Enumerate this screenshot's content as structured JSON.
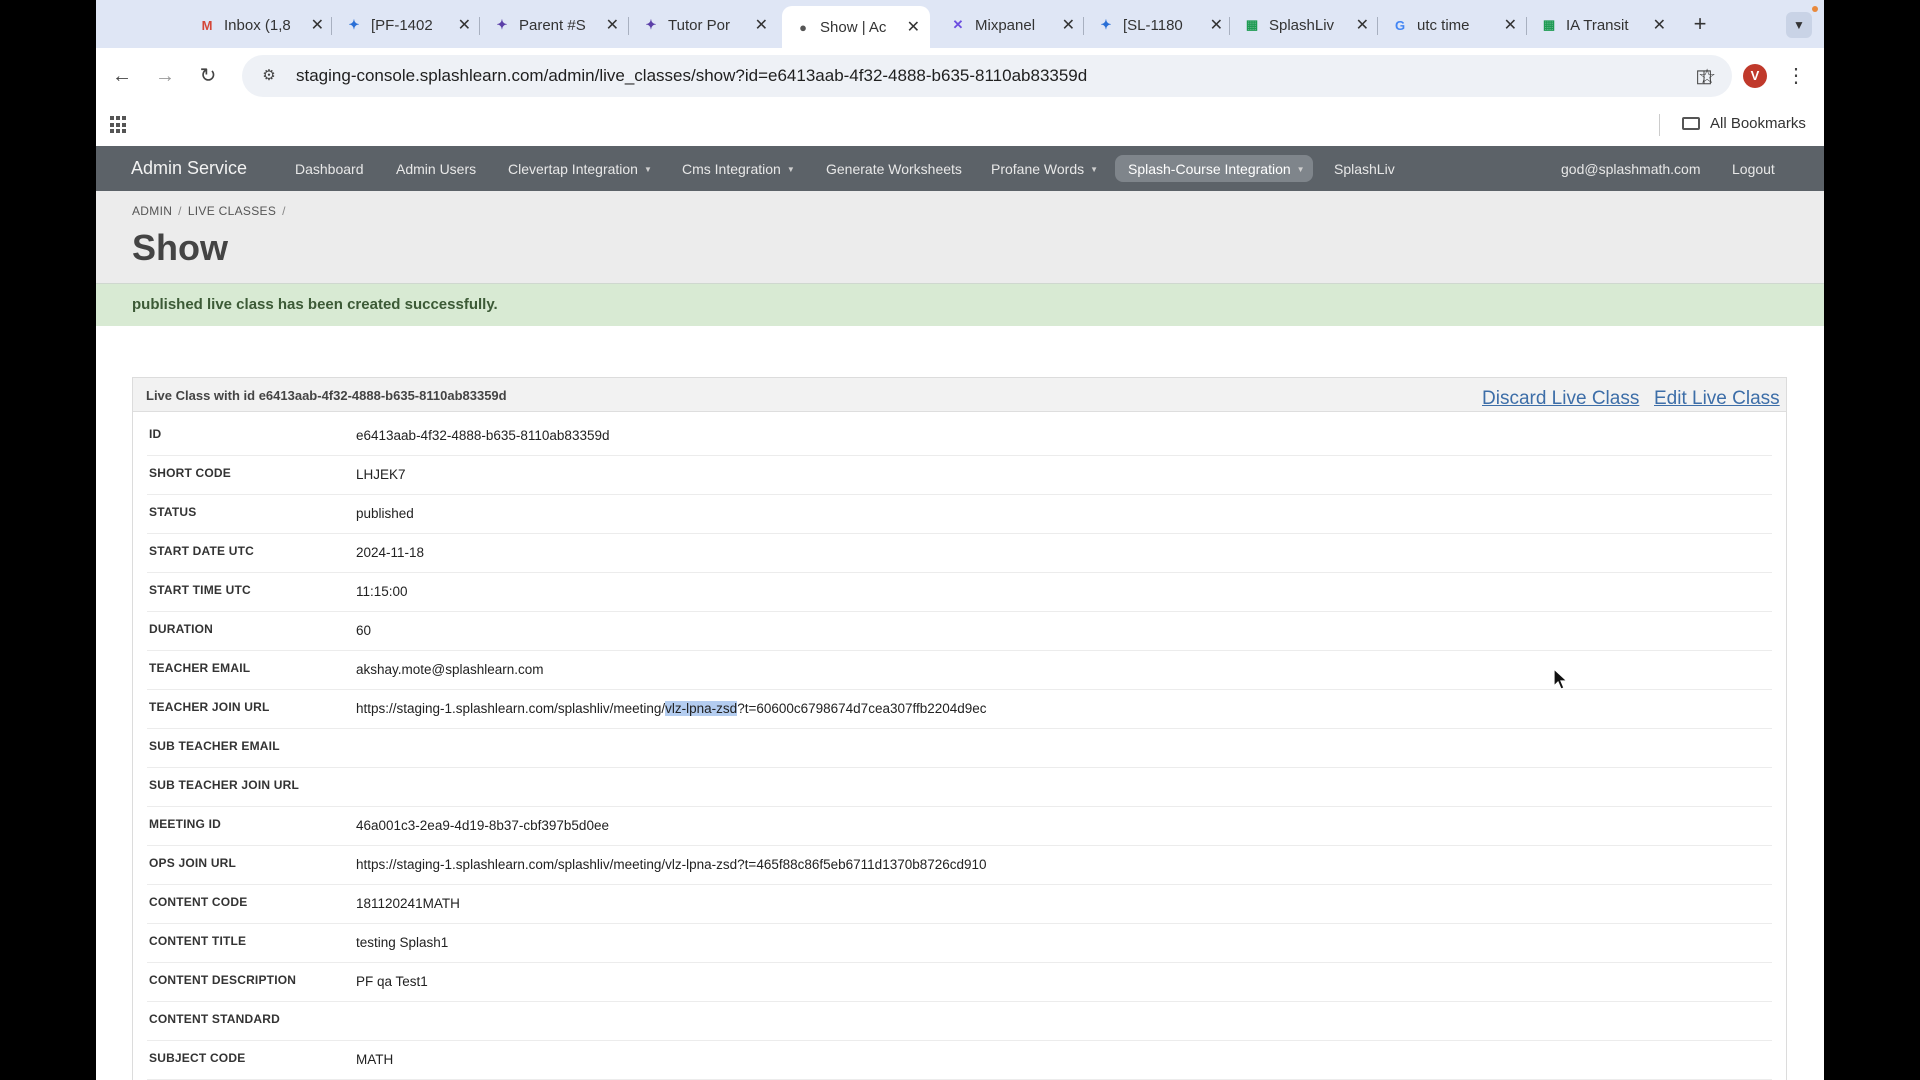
{
  "browser": {
    "tabs": [
      {
        "label": "Inbox (1,8",
        "icon": "gmail-icon",
        "active": false
      },
      {
        "label": "[PF-1402",
        "icon": "jira-icon",
        "active": false
      },
      {
        "label": "Parent #S",
        "icon": "app-icon",
        "active": false
      },
      {
        "label": "Tutor Por",
        "icon": "app-icon",
        "active": false
      },
      {
        "label": "Show | Ac",
        "icon": "globe-icon",
        "active": true
      },
      {
        "label": "Mixpanel",
        "icon": "mixpanel-icon",
        "active": false
      },
      {
        "label": "[SL-1180",
        "icon": "jira-icon",
        "active": false
      },
      {
        "label": "SplashLiv",
        "icon": "sheets-icon",
        "active": false
      },
      {
        "label": "utc time",
        "icon": "google-icon",
        "active": false
      },
      {
        "label": "IA Transit",
        "icon": "sheets-icon",
        "active": false
      }
    ],
    "url_host": "staging-console.splashlearn.com",
    "url_path": "/admin/live_classes/show?id=e6413aab-4f32-4888-b635-8110ab83359d",
    "profile_initial": "V",
    "all_bookmarks": "All Bookmarks"
  },
  "nav": {
    "brand": "Admin Service",
    "items": [
      {
        "label": "Dashboard",
        "dropdown": false
      },
      {
        "label": "Admin Users",
        "dropdown": false
      },
      {
        "label": "Clevertap Integration",
        "dropdown": true
      },
      {
        "label": "Cms Integration",
        "dropdown": true
      },
      {
        "label": "Generate Worksheets",
        "dropdown": false
      },
      {
        "label": "Profane Words",
        "dropdown": true
      },
      {
        "label": "Splash-Course Integration",
        "dropdown": true
      },
      {
        "label": "SplashLiv",
        "dropdown": false
      }
    ],
    "user_email": "god@splashmath.com",
    "logout": "Logout"
  },
  "breadcrumb": [
    "ADMIN",
    "LIVE CLASSES"
  ],
  "page_title": "Show",
  "flash": "published live class has been created successfully.",
  "panel": {
    "title": "Live Class with id e6413aab-4f32-4888-b635-8110ab83359d",
    "discard_label": "Discard Live Class",
    "edit_label": "Edit Live Class",
    "rows": [
      {
        "key": "ID",
        "value": "e6413aab-4f32-4888-b635-8110ab83359d"
      },
      {
        "key": "SHORT CODE",
        "value": "LHJEK7"
      },
      {
        "key": "STATUS",
        "value": "published"
      },
      {
        "key": "START DATE UTC",
        "value": "2024-11-18"
      },
      {
        "key": "START TIME UTC",
        "value": "11:15:00"
      },
      {
        "key": "DURATION",
        "value": "60"
      },
      {
        "key": "TEACHER EMAIL",
        "value": "akshay.mote@splashlearn.com"
      },
      {
        "key": "TEACHER JOIN URL",
        "value": "https://staging-1.splashlearn.com/splashliv/meeting/vlz-lpna-zsd?t=60600c6798674d7cea307ffb2204d9ec",
        "highlight": "vlz-lpna-zsd"
      },
      {
        "key": "SUB TEACHER EMAIL",
        "value": ""
      },
      {
        "key": "SUB TEACHER JOIN URL",
        "value": ""
      },
      {
        "key": "MEETING ID",
        "value": "46a001c3-2ea9-4d19-8b37-cbf397b5d0ee"
      },
      {
        "key": "OPS JOIN URL",
        "value": "https://staging-1.splashlearn.com/splashliv/meeting/vlz-lpna-zsd?t=465f88c86f5eb6711d1370b8726cd910"
      },
      {
        "key": "CONTENT CODE",
        "value": "181120241MATH"
      },
      {
        "key": "CONTENT TITLE",
        "value": "testing Splash1"
      },
      {
        "key": "CONTENT DESCRIPTION",
        "value": "PF qa Test1"
      },
      {
        "key": "CONTENT STANDARD",
        "value": ""
      },
      {
        "key": "SUBJECT CODE",
        "value": "MATH"
      }
    ]
  }
}
